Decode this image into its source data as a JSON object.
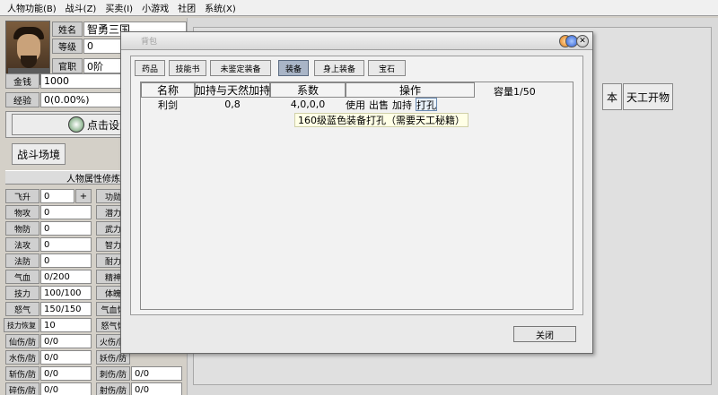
{
  "menu": [
    "人物功能(B)",
    "战斗(Z)",
    "买卖(I)",
    "小游戏",
    "社团",
    "系统(X)"
  ],
  "character": {
    "name_label": "姓名",
    "name_value": "智勇三国",
    "level_label": "等级",
    "level_value": "0",
    "rank_label": "官职",
    "rank_value": "0阶",
    "gold_label": "金钱",
    "gold_value": "1000",
    "exp_label": "经验",
    "exp_value": "0(0.00%)"
  },
  "left_buttons": {
    "setup": "点击设置",
    "battle": "战斗场境"
  },
  "attributes": {
    "header": "人物属性修炼",
    "left_rows": [
      {
        "label": "飞升",
        "value": "0"
      },
      {
        "label": "物攻",
        "value": "0"
      },
      {
        "label": "物防",
        "value": "0"
      },
      {
        "label": "法攻",
        "value": "0"
      },
      {
        "label": "法防",
        "value": "0"
      },
      {
        "label": "气血",
        "value": "0/200"
      },
      {
        "label": "技力",
        "value": "100/100"
      },
      {
        "label": "怒气",
        "value": "150/150"
      },
      {
        "label": "技力恢复",
        "value": "10"
      },
      {
        "label": "仙伤/防",
        "value": "0/0"
      },
      {
        "label": "水伤/防",
        "value": "0/0"
      },
      {
        "label": "斩伤/防",
        "value": "0/0"
      },
      {
        "label": "碎伤/防",
        "value": "0/0"
      }
    ],
    "right_rows": [
      {
        "label": "功勋",
        "value": ""
      },
      {
        "label": "潜力",
        "value": ""
      },
      {
        "label": "武力",
        "value": ""
      },
      {
        "label": "智力",
        "value": ""
      },
      {
        "label": "耐力",
        "value": ""
      },
      {
        "label": "精神",
        "value": ""
      },
      {
        "label": "体魄",
        "value": ""
      },
      {
        "label": "气血恢",
        "value": ""
      },
      {
        "label": "怒气恢",
        "value": ""
      },
      {
        "label": "火伤/防",
        "value": ""
      },
      {
        "label": "妖伤/防",
        "value": ""
      },
      {
        "label": "刺伤/防",
        "value": "0/0"
      },
      {
        "label": "射伤/防",
        "value": "0/0"
      }
    ],
    "plus_button": "+"
  },
  "background_buttons": {
    "btn1": "本",
    "btn2": "天工开物"
  },
  "dialog": {
    "title": "背包",
    "tabs": [
      {
        "label": "药品",
        "active": false
      },
      {
        "label": "技能书",
        "active": false
      },
      {
        "label": "未鉴定装备",
        "active": false
      },
      {
        "label": "装备",
        "active": true
      },
      {
        "label": "身上装备",
        "active": false
      },
      {
        "label": "宝石",
        "active": false
      }
    ],
    "columns": [
      "名称",
      "加持与天然加持",
      "系数",
      "操作"
    ],
    "capacity": "容量1/50",
    "rows": [
      {
        "name": "利剑",
        "bonus": "0,8",
        "coef": "4,0,0,0",
        "actions": [
          "使用",
          "出售",
          "加持",
          "打孔"
        ]
      }
    ],
    "tooltip": "160级蓝色装备打孔（需要天工秘籍）",
    "close": "关闭"
  },
  "colors": {
    "active_tab": "#a9b5c7",
    "tooltip_bg": "#ffffe6"
  }
}
